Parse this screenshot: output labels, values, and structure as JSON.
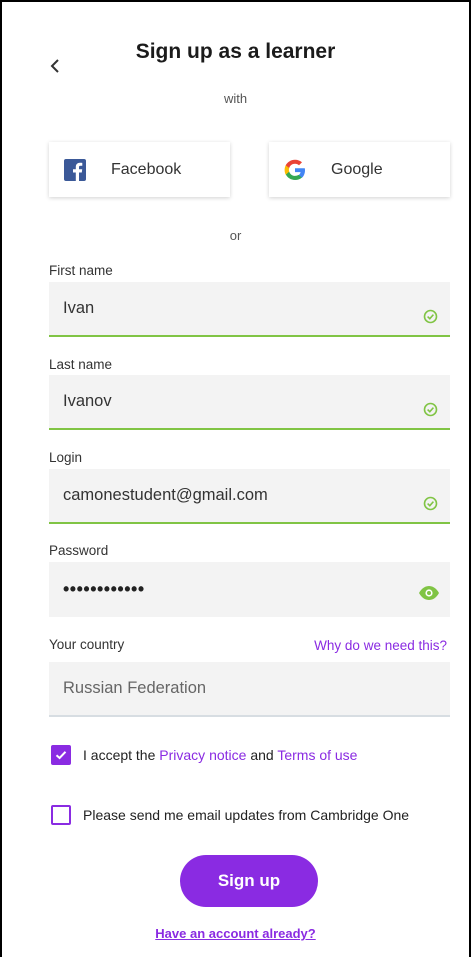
{
  "header": {
    "title": "Sign up as a learner",
    "with_text": "with"
  },
  "social": {
    "facebook_label": "Facebook",
    "google_label": "Google"
  },
  "or_text": "or",
  "form": {
    "first_name": {
      "label": "First name",
      "value": "Ivan",
      "status": "valid"
    },
    "last_name": {
      "label": "Last name",
      "value": "Ivanov",
      "status": "valid"
    },
    "login": {
      "label": "Login",
      "value": "camonestudent@gmail.com",
      "status": "valid"
    },
    "password": {
      "label": "Password",
      "value": "••••••••••••"
    },
    "country": {
      "label": "Your country",
      "value": "Russian Federation",
      "why_link": "Why do we need this?"
    }
  },
  "consents": {
    "accept": {
      "checked": true,
      "prefix": "I accept the ",
      "privacy_link": "Privacy notice",
      "middle": " and ",
      "terms_link": "Terms of use"
    },
    "updates": {
      "checked": false,
      "text": "Please send me email updates from Cambridge One"
    }
  },
  "actions": {
    "signup_label": "Sign up",
    "have_account": "Have an account already?"
  },
  "colors": {
    "accent": "#8a2be2",
    "valid": "#80c444",
    "facebook": "#3b5998"
  }
}
